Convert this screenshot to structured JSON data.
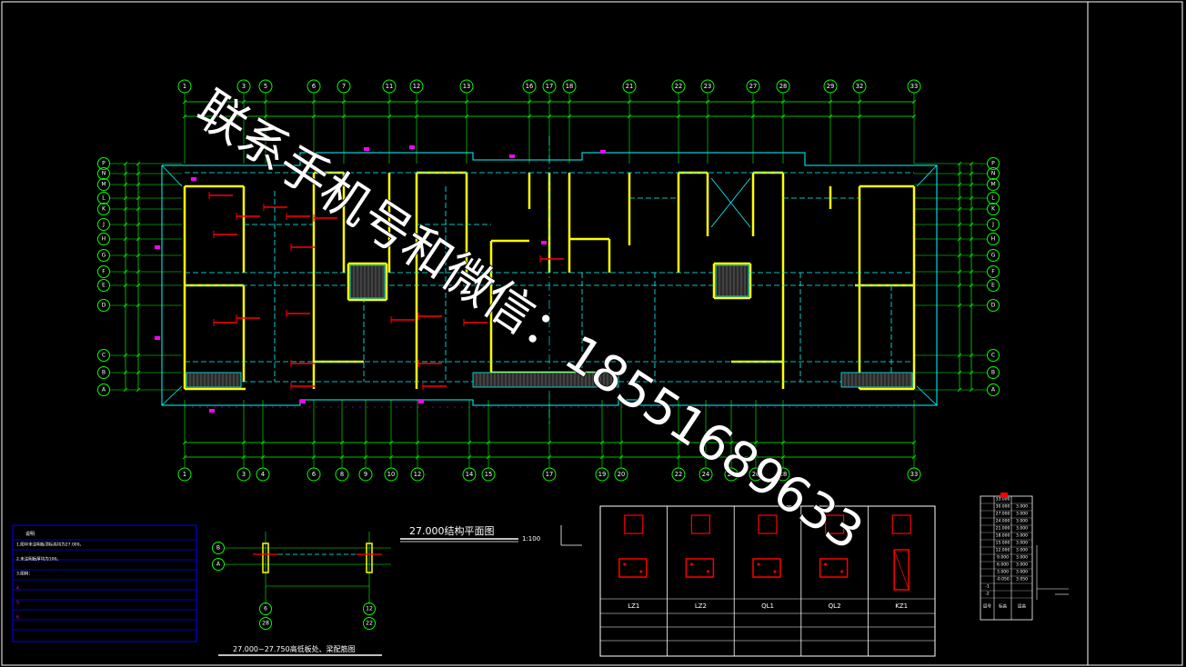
{
  "plan_title": "27.000结构平面图",
  "plan_scale": "1:100",
  "detail_title": "27.000~27.750高低板处、梁配筋图",
  "axes_top": [
    "1",
    "3",
    "5",
    "6",
    "7",
    "11",
    "12",
    "13",
    "16",
    "17",
    "18",
    "21",
    "22",
    "23",
    "27",
    "28",
    "29",
    "32",
    "33"
  ],
  "axes_bottom": [
    "1",
    "3",
    "4",
    "6",
    "8",
    "9",
    "10",
    "12",
    "14",
    "15",
    "17",
    "19",
    "20",
    "22",
    "24",
    "25",
    "26",
    "28",
    "33"
  ],
  "axes_rows": [
    "P",
    "N",
    "M",
    "L",
    "K",
    "J",
    "H",
    "G",
    "F",
    "E",
    "D",
    "C",
    "B",
    "A"
  ],
  "detail_axes_rows": [
    "B",
    "A"
  ],
  "detail_axes_cols": [
    {
      "top": "6",
      "bottom": "28"
    },
    {
      "top": "12",
      "bottom": "22"
    }
  ],
  "notes_title": "说明",
  "notes": [
    "1.图中未注明板顶标高均为27.000。",
    "2.未注明板厚均为100。",
    "3.图例：",
    "4.",
    "5.",
    "6."
  ],
  "section_labels": [
    "LZ1",
    "LZ2",
    "QL1",
    "QL2",
    "KZ1"
  ],
  "table_header": [
    "层号",
    "标高",
    "层高"
  ],
  "level_table": [
    [
      "",
      "33.000",
      ""
    ],
    [
      "",
      "30.000",
      "3.000"
    ],
    [
      "",
      "27.000",
      "3.000"
    ],
    [
      "",
      "24.000",
      "3.000"
    ],
    [
      "",
      "21.000",
      "3.000"
    ],
    [
      "",
      "18.000",
      "3.000"
    ],
    [
      "",
      "15.000",
      "3.000"
    ],
    [
      "",
      "12.000",
      "3.000"
    ],
    [
      "",
      "9.000",
      "3.000"
    ],
    [
      "",
      "6.000",
      "3.000"
    ],
    [
      "",
      "3.000",
      "3.000"
    ],
    [
      "",
      "-0.050",
      "3.050"
    ],
    [
      "-1",
      "",
      ""
    ],
    [
      "-2",
      "",
      ""
    ]
  ],
  "watermark_text": "联系手机号和微信：18551689633",
  "colors": {
    "background": "#000000",
    "axis": "#00ff00",
    "wall": "#ffff00",
    "beam": "#00ffff",
    "rebar": "#ff0000",
    "annot": "#ff00ff",
    "frame": "#ffffff",
    "notes_border": "#0000ff",
    "watermark": "#ffffff"
  }
}
